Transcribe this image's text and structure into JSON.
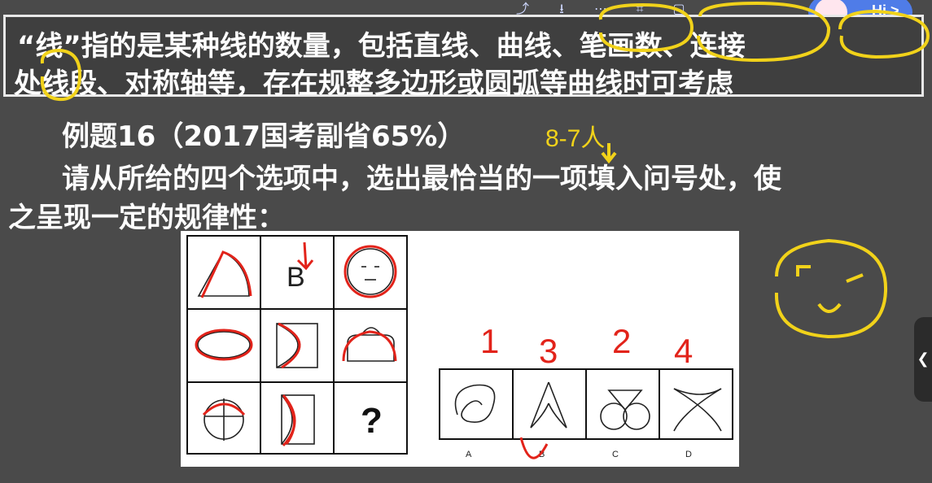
{
  "tip": {
    "line1": "“线”指的是某种线的数量，包括直线、曲线、笔画数、连接",
    "line2": "处线段、对称轴等，存在规整多边形或圆弧等曲线时可考虑"
  },
  "question": {
    "title": "例题16（2017国考副省65%）",
    "line1": "请从所给的四个选项中，选出最恰当的一项填入问号处，使",
    "line2": "之呈现一定的规律性："
  },
  "figure": {
    "question_mark": "?",
    "grid_B_label": "B",
    "options": [
      "A",
      "B",
      "C",
      "D"
    ]
  },
  "annotations": {
    "handwritten_count": "8-7人",
    "numbers": [
      "1",
      "3",
      "2",
      "4"
    ]
  },
  "toolbar": {
    "hi_label": "Hi >"
  },
  "icons": {
    "share": "share-icon",
    "download": "download-icon",
    "more": "more-icon",
    "crop": "crop-icon",
    "window": "window-icon"
  }
}
